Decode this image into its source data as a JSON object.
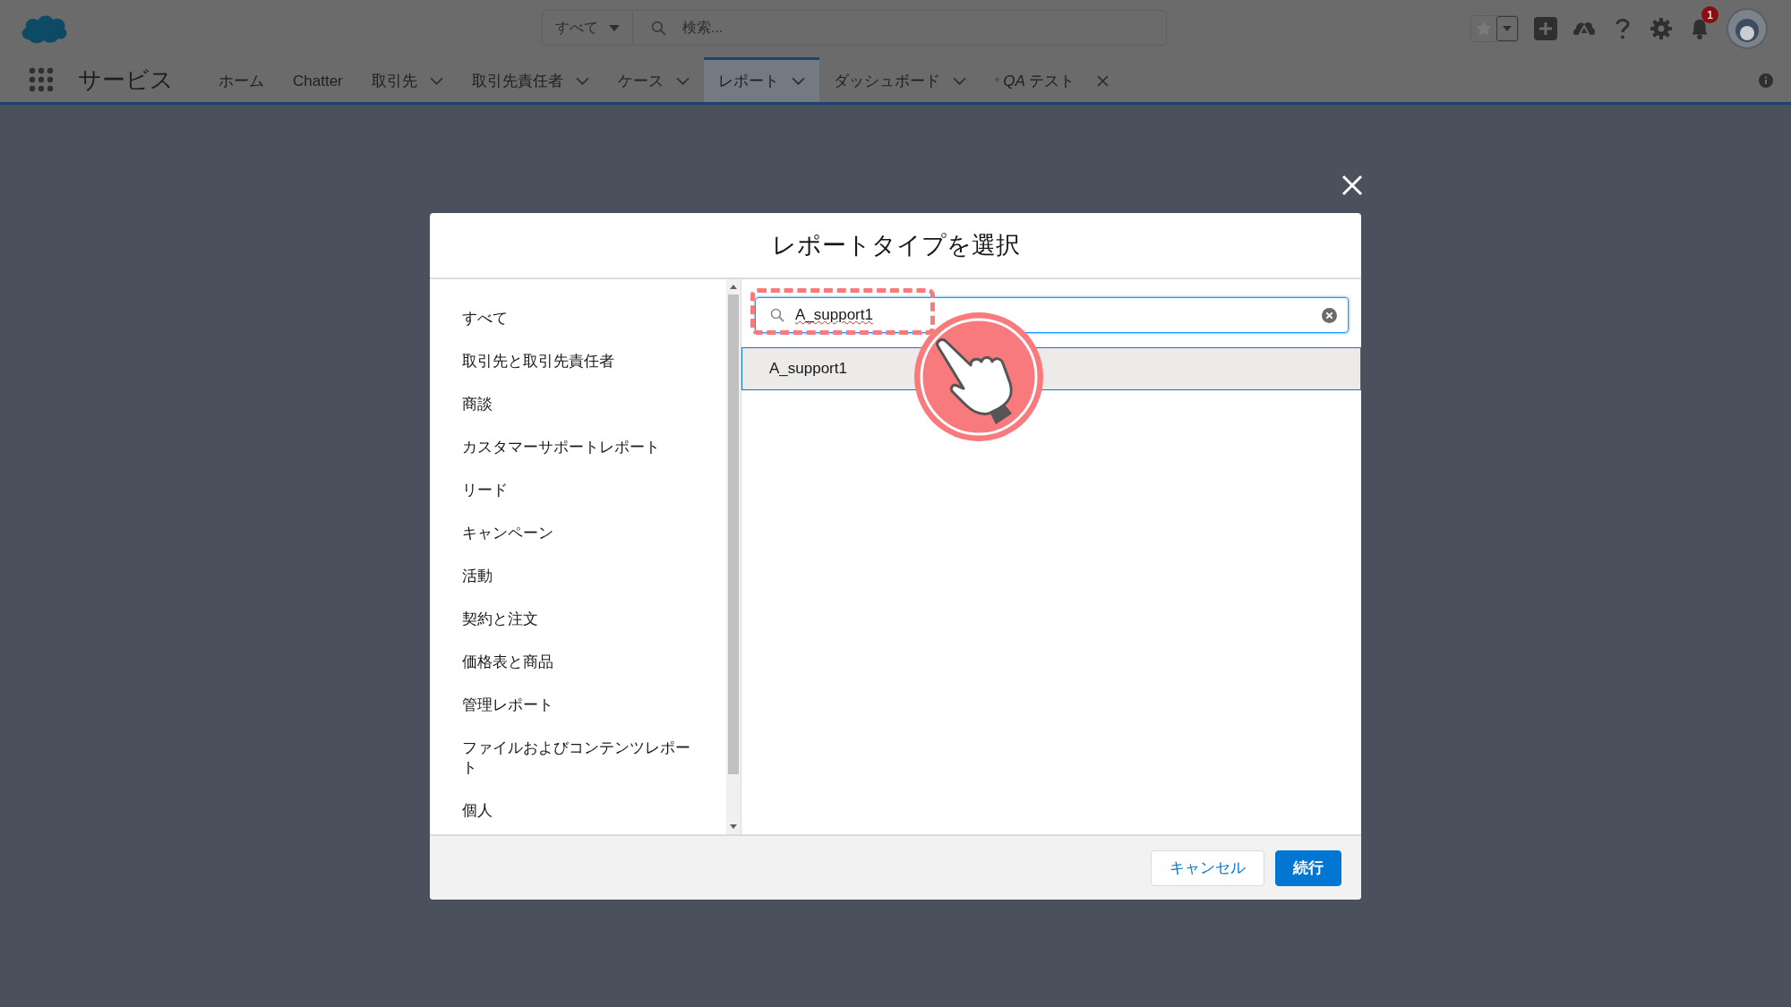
{
  "header": {
    "search_scope": "すべて",
    "search_placeholder": "検索...",
    "notification_count": "1"
  },
  "nav": {
    "app_name": "サービス",
    "tabs": [
      {
        "label": "ホーム",
        "kind": "plain",
        "selected": false
      },
      {
        "label": "Chatter",
        "kind": "plain",
        "selected": false
      },
      {
        "label": "取引先",
        "kind": "menu",
        "selected": false
      },
      {
        "label": "取引先責任者",
        "kind": "menu",
        "selected": false
      },
      {
        "label": "ケース",
        "kind": "menu",
        "selected": false
      },
      {
        "label": "レポート",
        "kind": "menu",
        "selected": true
      },
      {
        "label": "ダッシュボード",
        "kind": "menu",
        "selected": false
      },
      {
        "label": "*QA* テスト",
        "kind": "closable",
        "prefix": "*",
        "selected": false
      }
    ]
  },
  "modal": {
    "title": "レポートタイプを選択",
    "categories": [
      "すべて",
      "取引先と取引先責任者",
      "商談",
      "カスタマーサポートレポート",
      "リード",
      "キャンペーン",
      "活動",
      "契約と注文",
      "価格表と商品",
      "管理レポート",
      "ファイルおよびコンテンツレポート",
      "個人"
    ],
    "search": {
      "value": "A_support1"
    },
    "results": [
      {
        "label": "A_support1",
        "selected": true
      }
    ],
    "buttons": [
      {
        "label": "キャンセル",
        "kind": "neutral"
      },
      {
        "label": "続行",
        "kind": "brand"
      }
    ]
  }
}
